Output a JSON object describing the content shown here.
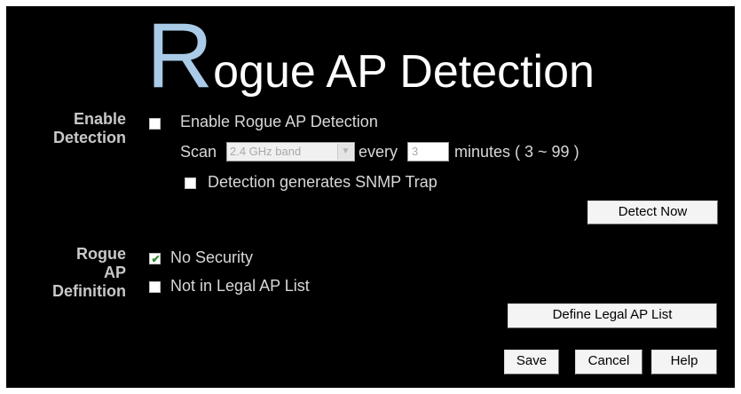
{
  "title": {
    "first_letter": "R",
    "rest": "ogue AP Detection"
  },
  "enable_detection": {
    "section_label": [
      "Enable",
      "Detection"
    ],
    "enable_checkbox_label": "Enable Rogue AP Detection",
    "enable_checked": false,
    "scan_label": "Scan",
    "band_selected": "2.4 GHz band",
    "every_label": "every",
    "interval_value": "3",
    "minutes_label": "minutes ( 3 ~ 99 )",
    "snmp_checkbox_label": "Detection generates SNMP Trap",
    "snmp_checked": false,
    "detect_now_button": "Detect Now"
  },
  "rogue_definition": {
    "section_label": [
      "Rogue",
      "AP",
      "Definition"
    ],
    "no_security_label": "No Security",
    "no_security_checked": true,
    "not_in_legal_label": "Not in Legal AP List",
    "not_in_legal_checked": false,
    "define_legal_button": "Define Legal AP List"
  },
  "footer": {
    "save": "Save",
    "cancel": "Cancel",
    "help": "Help"
  },
  "colors": {
    "background": "#000000",
    "title_accent": "#a9cbe8",
    "text": "#d8d8d8"
  }
}
